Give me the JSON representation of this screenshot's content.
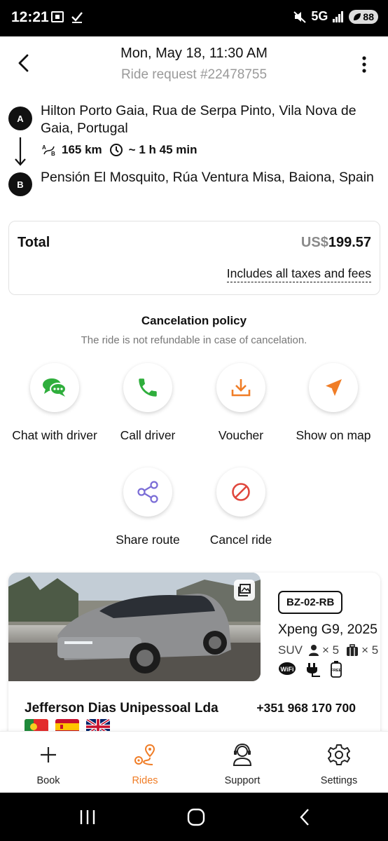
{
  "status_bar": {
    "time": "12:21",
    "network": "5G",
    "battery": "88"
  },
  "header": {
    "date": "Mon, May 18, 11:30 AM",
    "subtitle": "Ride request #22478755"
  },
  "route": {
    "pin_a": "A",
    "pin_b": "B",
    "pickup": "Hilton Porto Gaia, Rua de Serpa Pinto, Vila Nova de Gaia, Portugal",
    "dropoff": "Pensión El Mosquito, Rúa Ventura Misa, Baiona, Spain",
    "distance": "165 km",
    "duration": "~ 1 h 45 min"
  },
  "total": {
    "label": "Total",
    "currency": "US$",
    "amount": "199.57",
    "taxes_note": "Includes all taxes and fees"
  },
  "policy": {
    "title": "Cancelation policy",
    "text": "The ride is not refundable in case of cancelation."
  },
  "actions": {
    "chat": "Chat with driver",
    "call": "Call driver",
    "voucher": "Voucher",
    "map": "Show on map",
    "share": "Share route",
    "cancel": "Cancel ride"
  },
  "car": {
    "plate": "BZ-02-RB",
    "model": "Xpeng G9, 2025",
    "class": "SUV",
    "passengers": "× 5",
    "luggage": "× 5",
    "amenities": [
      "wifi-icon",
      "charger-icon",
      "free-water-icon"
    ]
  },
  "driver": {
    "company": "Jefferson Dias Unipessoal Lda",
    "phone": "+351 968 170 700",
    "languages": [
      "Portuguese",
      "Spanish",
      "English"
    ]
  },
  "bottom_nav": {
    "book": "Book",
    "rides": "Rides",
    "support": "Support",
    "settings": "Settings",
    "active": "rides"
  },
  "colors": {
    "accent": "#f07d26",
    "chat_green": "#2fae3c",
    "share_purple": "#7a6cd6",
    "cancel_red": "#e0463c"
  }
}
